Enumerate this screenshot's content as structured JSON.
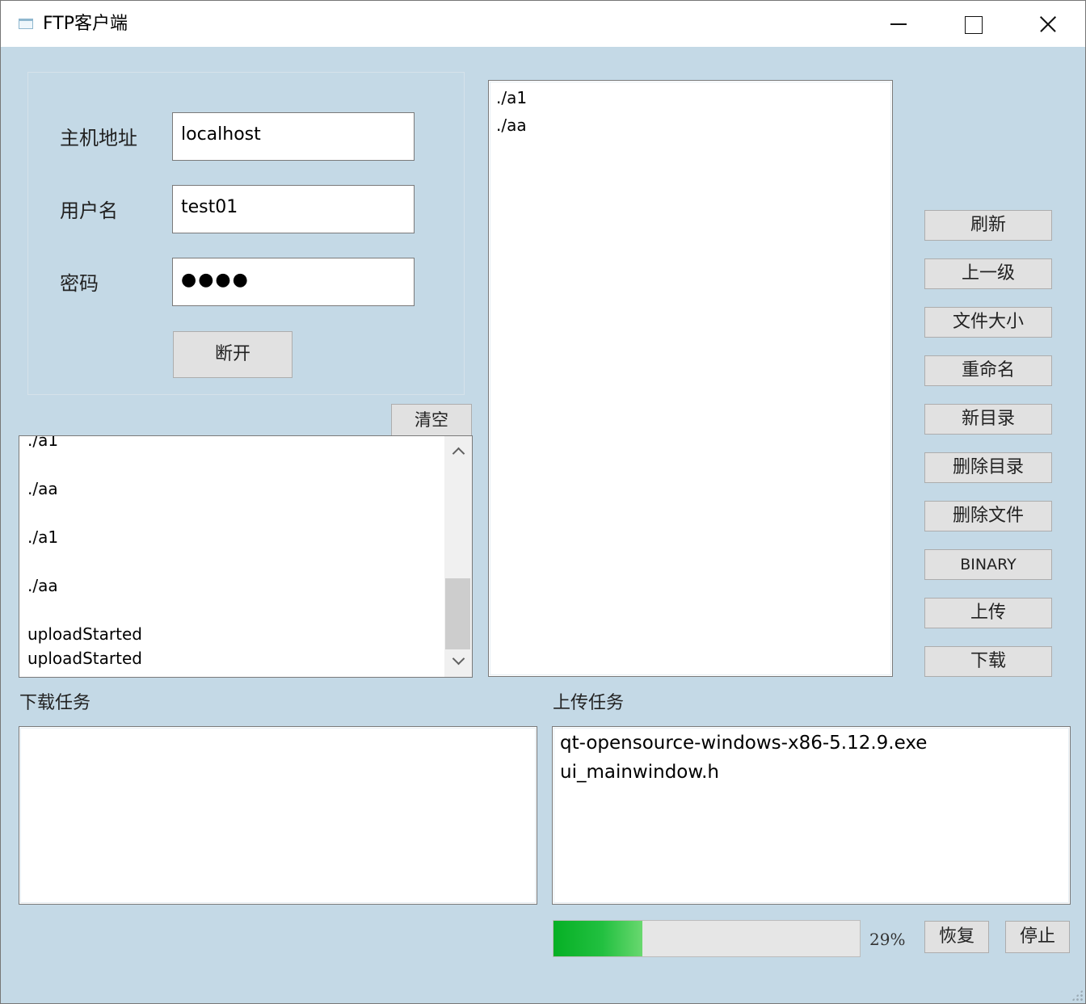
{
  "window": {
    "title": "FTP客户端"
  },
  "login": {
    "host_label": "主机地址",
    "host_value": "localhost",
    "user_label": "用户名",
    "user_value": "test01",
    "password_label": "密码",
    "password_value": "●●●●",
    "disconnect_label": "断开"
  },
  "log": {
    "clear_label": "清空",
    "lines": [
      "./a1",
      "./aa",
      "./a1",
      "./aa",
      "uploadStarted",
      "uploadStarted"
    ]
  },
  "remote": {
    "items": [
      "./a1",
      "./aa"
    ]
  },
  "actions": {
    "refresh": "刷新",
    "parent": "上一级",
    "file_size": "文件大小",
    "rename": "重命名",
    "new_dir": "新目录",
    "delete_dir": "删除目录",
    "delete_file": "删除文件",
    "binary": "BINARY",
    "upload": "上传",
    "download": "下载"
  },
  "tasks": {
    "download_label": "下载任务",
    "upload_label": "上传任务",
    "upload_items": [
      "qt-opensource-windows-x86-5.12.9.exe",
      "ui_mainwindow.h"
    ]
  },
  "progress": {
    "value": 29,
    "text": "29%",
    "resume_label": "恢复",
    "stop_label": "停止",
    "fill_color": "#06b025"
  }
}
